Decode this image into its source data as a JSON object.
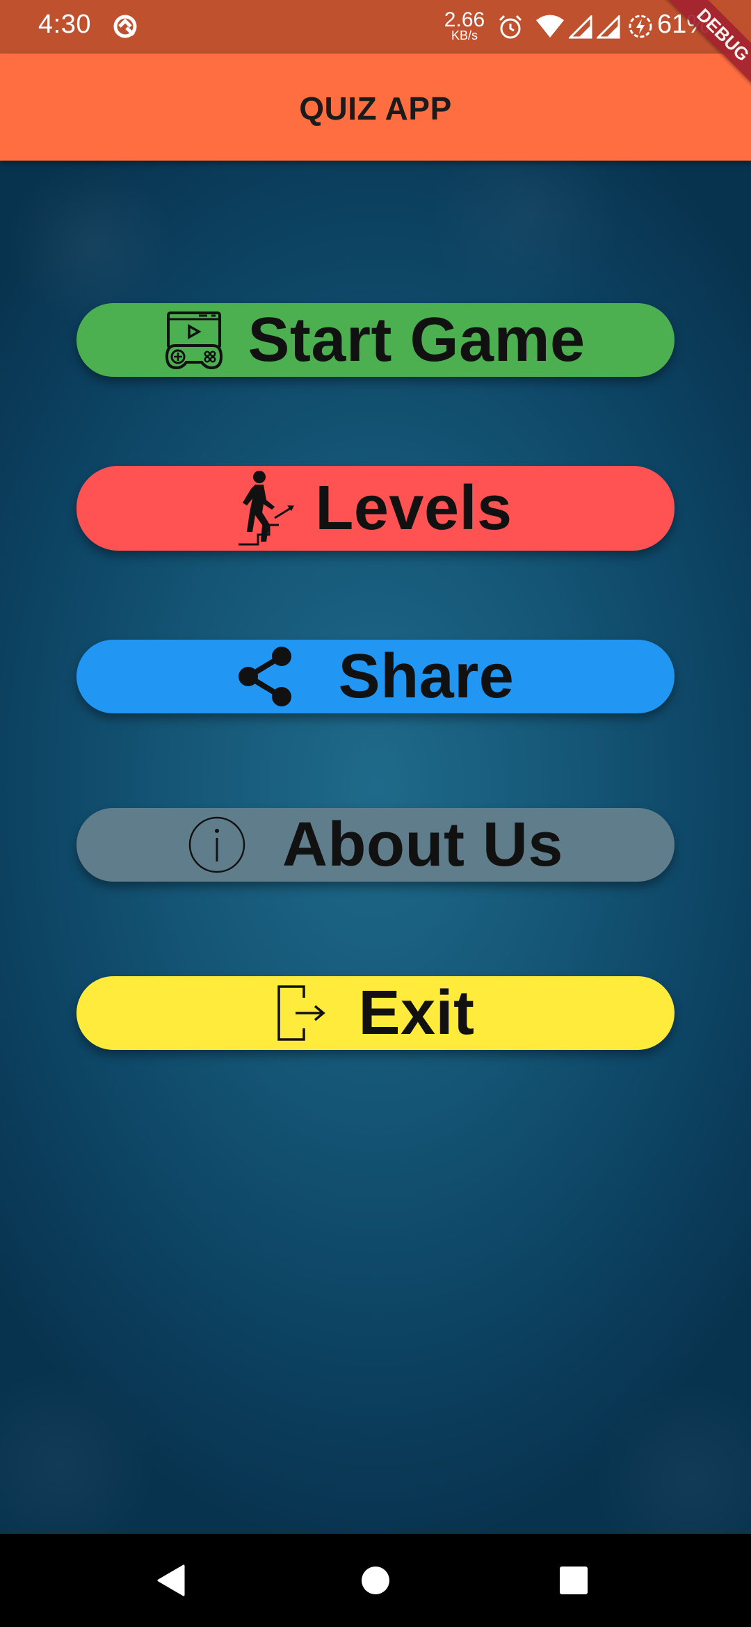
{
  "status_bar": {
    "time": "4:30",
    "net_speed": "2.66",
    "net_unit": "KB/s",
    "battery": "61%",
    "icons": [
      "sync-icon",
      "alarm-icon",
      "wifi-icon",
      "signal-icon",
      "signal-icon",
      "battery-charging-icon"
    ]
  },
  "debug_banner": "DEBUG",
  "app_bar": {
    "title": "QUIZ APP",
    "color": "#ff6e40"
  },
  "menu": {
    "start": {
      "label": "Start Game",
      "icon": "gamepad-icon",
      "color": "#4caf50"
    },
    "levels": {
      "label": "Levels",
      "icon": "climbing-stairs-icon",
      "color": "#ff5252"
    },
    "share": {
      "label": "Share",
      "icon": "share-icon",
      "color": "#2196f3"
    },
    "about": {
      "label": "About Us",
      "icon": "info-icon",
      "color": "#607d8b"
    },
    "exit": {
      "label": "Exit",
      "icon": "exit-icon",
      "color": "#ffeb3b"
    }
  },
  "nav_bar": {
    "icons": [
      "back-icon",
      "home-icon",
      "recents-icon"
    ]
  }
}
